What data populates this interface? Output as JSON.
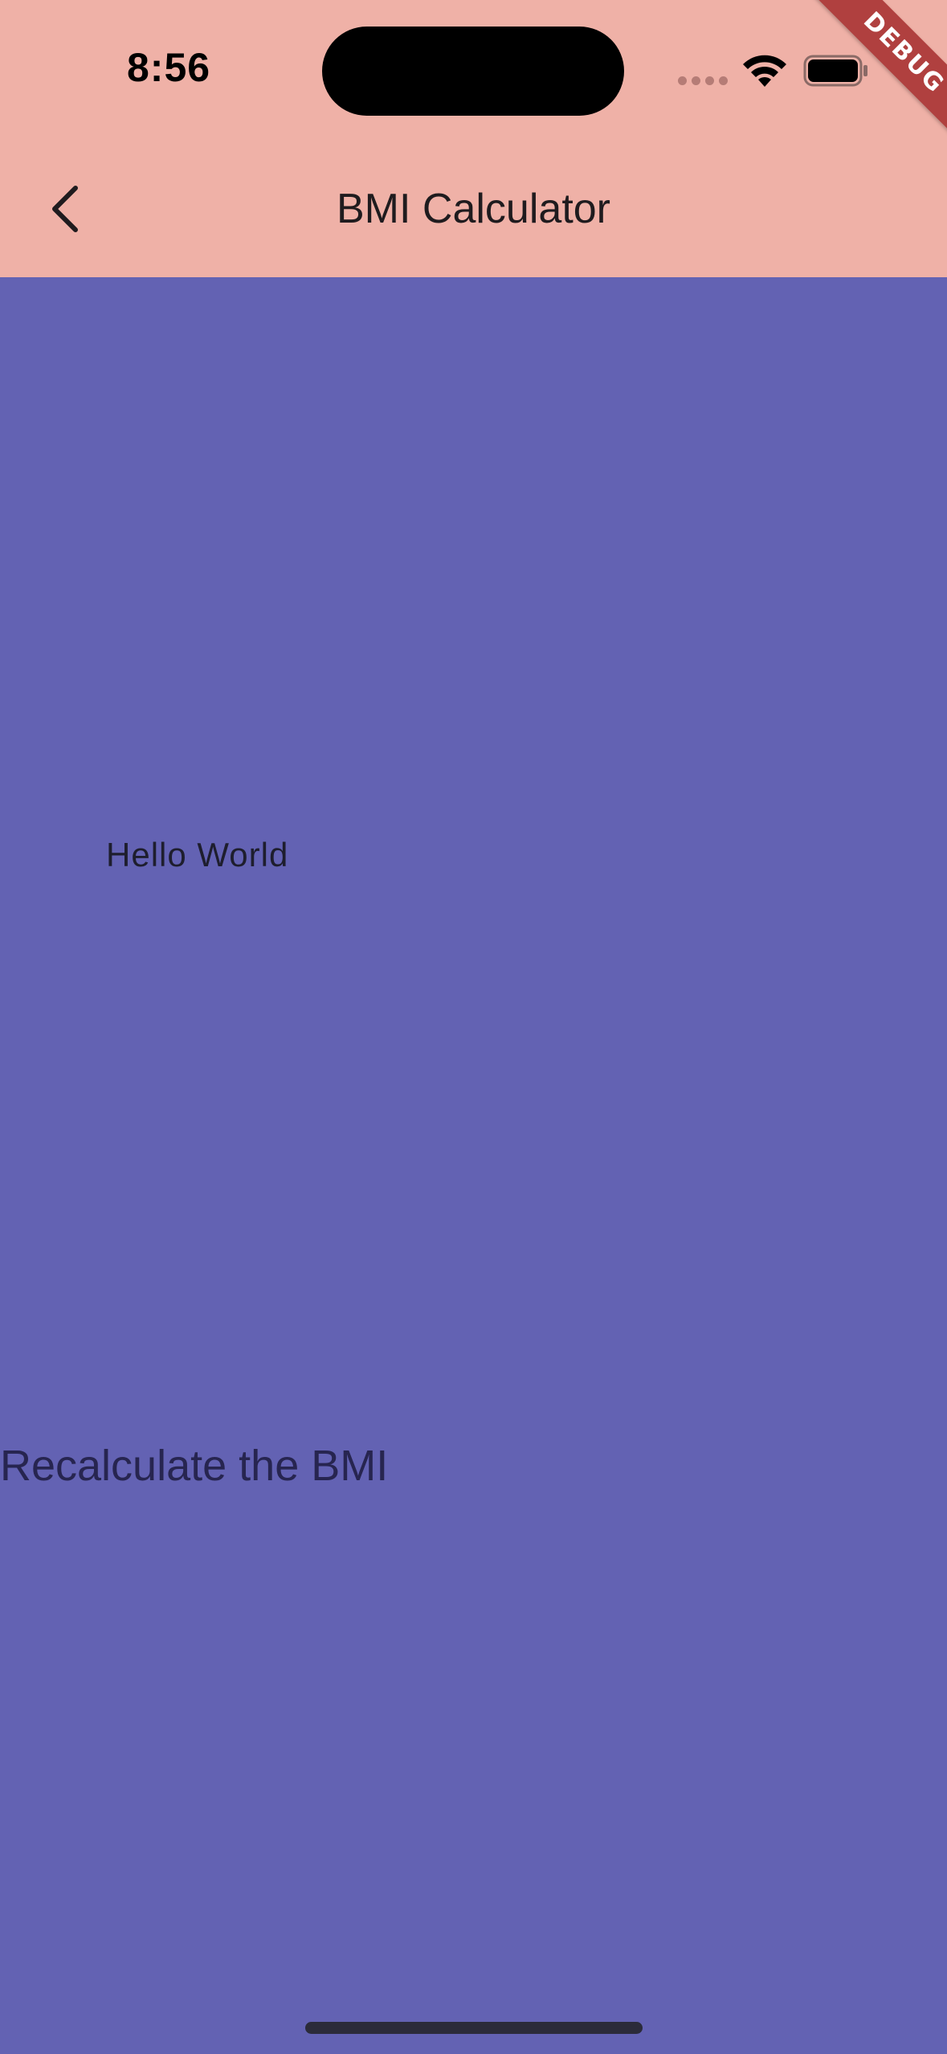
{
  "status_bar": {
    "time": "8:56",
    "icons": [
      "signal-dots-icon",
      "wifi-icon",
      "battery-icon"
    ]
  },
  "debug_banner": "DEBUG",
  "nav": {
    "back_icon": "chevron-left-icon",
    "title": "BMI Calculator"
  },
  "body": {
    "hello_text": "Hello World",
    "recalculate_label": "Recalculate the BMI"
  },
  "colors": {
    "app_bar": "#EFB1A7",
    "background": "#6362B3",
    "debug_banner": "#B0403F"
  }
}
